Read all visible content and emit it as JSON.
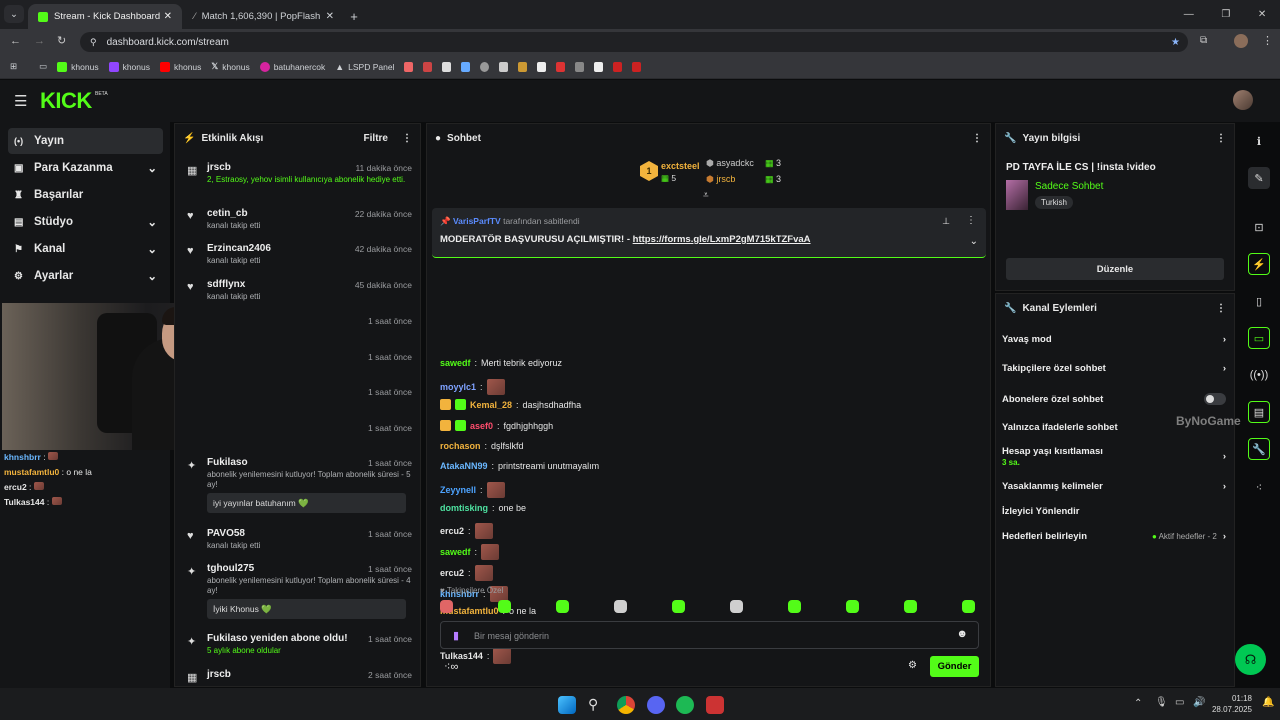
{
  "browser": {
    "tabs": [
      {
        "title": "Stream - Kick Dashboard",
        "active": true
      },
      {
        "title": "Match 1,606,390 | PopFlash",
        "active": false
      }
    ],
    "url": "dashboard.kick.com/stream",
    "bookmarks": [
      "khonus",
      "khonus",
      "khonus",
      "khonus",
      "batuhanercok",
      "LSPD Panel"
    ]
  },
  "brand": {
    "logo": "KICK",
    "beta": "BETA",
    "accent": "#53fc18"
  },
  "nav": {
    "items": [
      {
        "label": "Yayın",
        "icon": "broadcast-icon",
        "active": true
      },
      {
        "label": "Para Kazanma",
        "icon": "money-icon",
        "chevron": true
      },
      {
        "label": "Başarılar",
        "icon": "trophy-icon"
      },
      {
        "label": "Stüdyo",
        "icon": "studio-icon",
        "chevron": true
      },
      {
        "label": "Kanal",
        "icon": "channel-icon",
        "chevron": true
      },
      {
        "label": "Ayarlar",
        "icon": "gear-icon",
        "chevron": true
      }
    ]
  },
  "overlay_chat": [
    {
      "user": "khnshbrr",
      "msg": ""
    },
    {
      "user": "mustafamtlu0",
      "msg": "o ne la"
    },
    {
      "user": "ercu2",
      "msg": ""
    },
    {
      "user": "Tulkas144",
      "msg": ""
    }
  ],
  "activity": {
    "title": "Etkinlik Akışı",
    "filter": "Filtre",
    "items": [
      {
        "name": "jrscb",
        "time": "11 dakika önce",
        "desc": "2, Estraosy, yehov isimli kullanıcıya abonelik hediye etti.",
        "icon": "gift-icon"
      },
      {
        "name": "cetin_cb",
        "time": "22 dakika önce",
        "desc": "kanalı takip etti",
        "icon": "heart-icon"
      },
      {
        "name": "Erzincan2406",
        "time": "42 dakika önce",
        "desc": "kanalı takip etti",
        "icon": "heart-icon"
      },
      {
        "name": "sdfflynx",
        "time": "45 dakika önce",
        "desc": "kanalı takip etti",
        "icon": "heart-icon"
      },
      {
        "name": "",
        "time": "1 saat önce",
        "desc": "",
        "icon": ""
      },
      {
        "name": "",
        "time": "1 saat önce",
        "desc": "",
        "icon": ""
      },
      {
        "name": "",
        "time": "1 saat önce",
        "desc": "",
        "icon": ""
      },
      {
        "name": "",
        "time": "1 saat önce",
        "desc": "",
        "icon": ""
      },
      {
        "name": "Fukilaso",
        "time": "1 saat önce",
        "desc": "abonelik yenilemesini kutluyor! Toplam abonelik süresi - 5 ay!",
        "quote": "iyi yayınlar batuhanım 💚",
        "icon": "star-icon"
      },
      {
        "name": "PAVO58",
        "time": "1 saat önce",
        "desc": "kanalı takip etti",
        "icon": "heart-icon"
      },
      {
        "name": "tghoul275",
        "time": "1 saat önce",
        "desc": "abonelik yenilemesini kutluyor! Toplam abonelik süresi - 4 ay!",
        "quote": "İyiki Khonus 💚",
        "icon": "star-icon"
      },
      {
        "name": "Fukilaso yeniden abone oldu!",
        "time": "1 saat önce",
        "desc": "5 aylık abone oldular",
        "icon": "star-icon"
      },
      {
        "name": "jrscb",
        "time": "2 saat önce",
        "desc": "",
        "icon": "gift-icon"
      }
    ]
  },
  "chat": {
    "title": "Sohbet",
    "top": [
      {
        "rank": "1",
        "user": "exctsteel",
        "count": "5"
      },
      {
        "user": "asyadckc",
        "count": "3"
      },
      {
        "user": "jrscb",
        "count": "3"
      }
    ],
    "pinned_by": "VarisParfTV",
    "pinned_suffix": "tarafından sabitlendi",
    "pinned_text": "MODERATÖR BAŞVURUSU AÇILMIŞTIR! - ",
    "pinned_link": "https://forms.gle/LxmP2gM715kTZFvaA",
    "messages": [
      {
        "user": "sawedf",
        "color": "#53fc18",
        "msg": "Merti tebrik ediyoruz"
      },
      {
        "user": "moyylc1",
        "color": "#7fa2ff",
        "msg": "",
        "emote": true
      },
      {
        "user": "Kemal_28",
        "color": "#f2b33d",
        "msg": "dasjhsdhadfha",
        "badges": true
      },
      {
        "user": "asef0",
        "color": "#ff4d6d",
        "msg": "fgdhjghhggh",
        "badges": true
      },
      {
        "user": "rochason",
        "color": "#f2b33d",
        "msg": "dşlfslkfd"
      },
      {
        "user": "AtakaNN99",
        "color": "#6ab7ff",
        "msg": "printstreami unutmayalım"
      },
      {
        "user": "Zeyynell",
        "color": "#4da3ff",
        "msg": "",
        "emote": true
      },
      {
        "user": "domtisking",
        "color": "#4ee1a0",
        "msg": "one be"
      },
      {
        "user": "ercu2",
        "color": "#e6e6e6",
        "msg": "",
        "emote": true
      },
      {
        "user": "sawedf",
        "color": "#53fc18",
        "msg": "",
        "emote": true
      },
      {
        "user": "ercu2",
        "color": "#e6e6e6",
        "msg": "",
        "emote": true
      },
      {
        "user": "khnshbrr",
        "color": "#6ab7ff",
        "msg": "",
        "emote": true
      },
      {
        "user": "mustafamtlu0",
        "color": "#f2b33d",
        "msg": "o ne la"
      },
      {
        "user": "ercu2",
        "color": "#e6e6e6",
        "msg": "",
        "emote": true
      },
      {
        "user": "Tulkas144",
        "color": "#e6e6e6",
        "msg": "",
        "emote": true
      }
    ],
    "followers_only": "Takipçilere Özel",
    "input_placeholder": "Bir mesaj gönderin",
    "send": "Gönder"
  },
  "stream_info": {
    "title": "Yayın bilgisi",
    "stream_title": "PD TAYFA İLE CS | !insta !video",
    "category": "Sadece Sohbet",
    "tag": "Turkish",
    "edit": "Düzenle"
  },
  "channel_actions": {
    "title": "Kanal Eylemleri",
    "items": [
      {
        "label": "Yavaş mod",
        "type": "arrow"
      },
      {
        "label": "Takipçilere özel sohbet",
        "type": "arrow"
      },
      {
        "label": "Abonelere özel sohbet",
        "type": "toggle"
      },
      {
        "label": "Yalnızca ifadelerle sohbet",
        "type": "none"
      },
      {
        "label": "Hesap yaşı kısıtlaması",
        "sub": "3 sa.",
        "type": "arrow"
      },
      {
        "label": "Yasaklanmış kelimeler",
        "type": "arrow"
      },
      {
        "label": "İzleyici Yönlendir",
        "type": "none"
      },
      {
        "label": "Hedefleri belirleyin",
        "status": "Aktif hedefler - 2",
        "type": "arrow"
      }
    ]
  },
  "watermark": "ByNoGame",
  "clock": {
    "time": "01:18",
    "date": "28.07.2025"
  }
}
